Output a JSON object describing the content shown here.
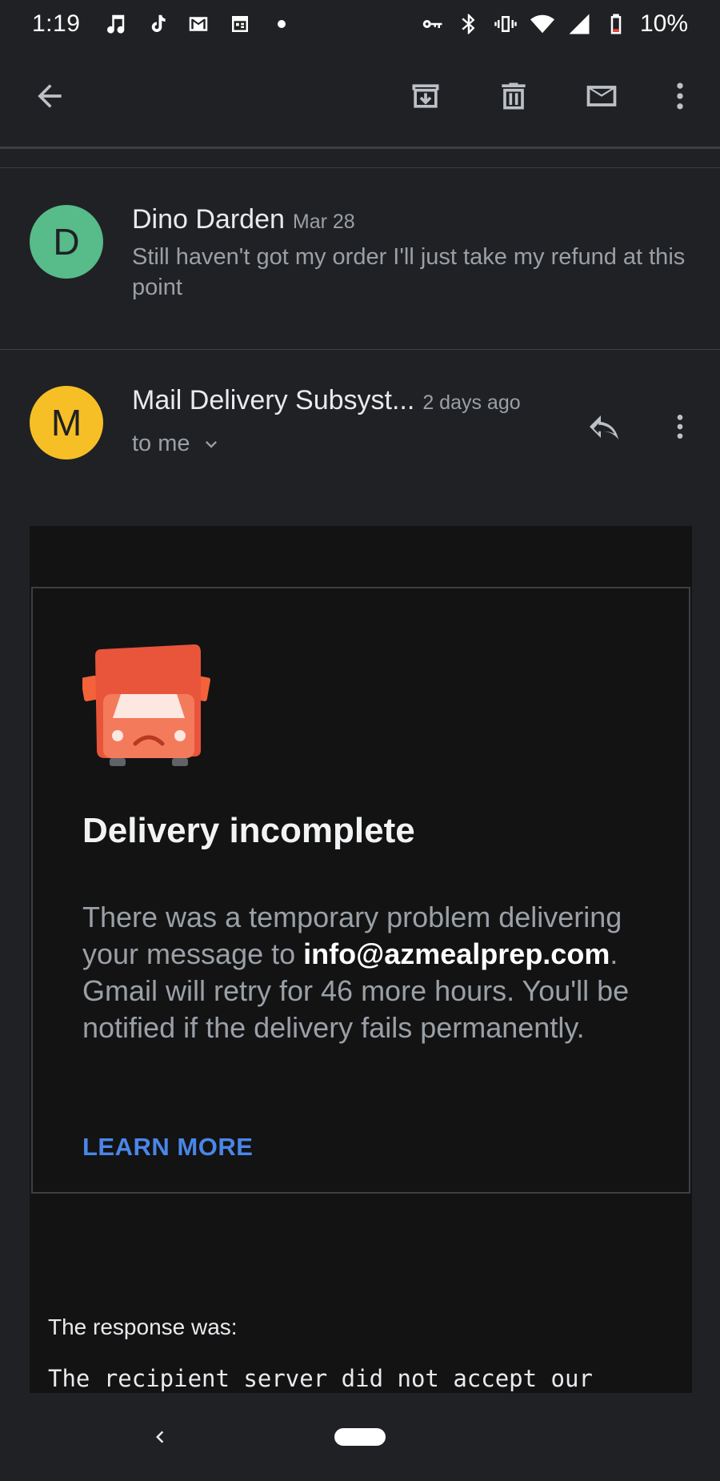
{
  "status_bar": {
    "time": "1:19",
    "battery": "10%",
    "left_icons": [
      "music-icon",
      "tiktok-icon",
      "gmail-icon",
      "calendar-icon",
      "dot-icon"
    ],
    "right_icons": [
      "vpn-key-icon",
      "bluetooth-icon",
      "vibrate-icon",
      "wifi-icon",
      "signal-icon",
      "battery-icon"
    ]
  },
  "toolbar": {
    "actions": [
      "back-arrow-icon",
      "archive-icon",
      "delete-icon",
      "mail-icon",
      "more-vert-icon"
    ]
  },
  "thread": [
    {
      "avatar_letter": "D",
      "avatar_color": "#57bb8a",
      "sender": "Dino Darden",
      "date": "Mar 28",
      "snippet": "Still haven't got my order I'll just take my refund at this point"
    },
    {
      "avatar_letter": "M",
      "avatar_color": "#f6bf26",
      "sender": "Mail Delivery Subsyst...",
      "date": "2 days ago",
      "recipient": "to me"
    }
  ],
  "email": {
    "title": "Delivery incomplete",
    "body_before": "There was a temporary problem delivering your message to ",
    "address": "info@azmealprep.com",
    "body_after": ". Gmail will retry for 46 more hours. You'll be notified if the delivery fails permanently.",
    "link": "LEARN MORE",
    "response_label": "The response was:",
    "response_text": "The recipient server did not accept our"
  },
  "colors": {
    "background": "#202124",
    "email_bg": "#131314",
    "link": "#4a86e8",
    "truck": "#f4623a"
  }
}
